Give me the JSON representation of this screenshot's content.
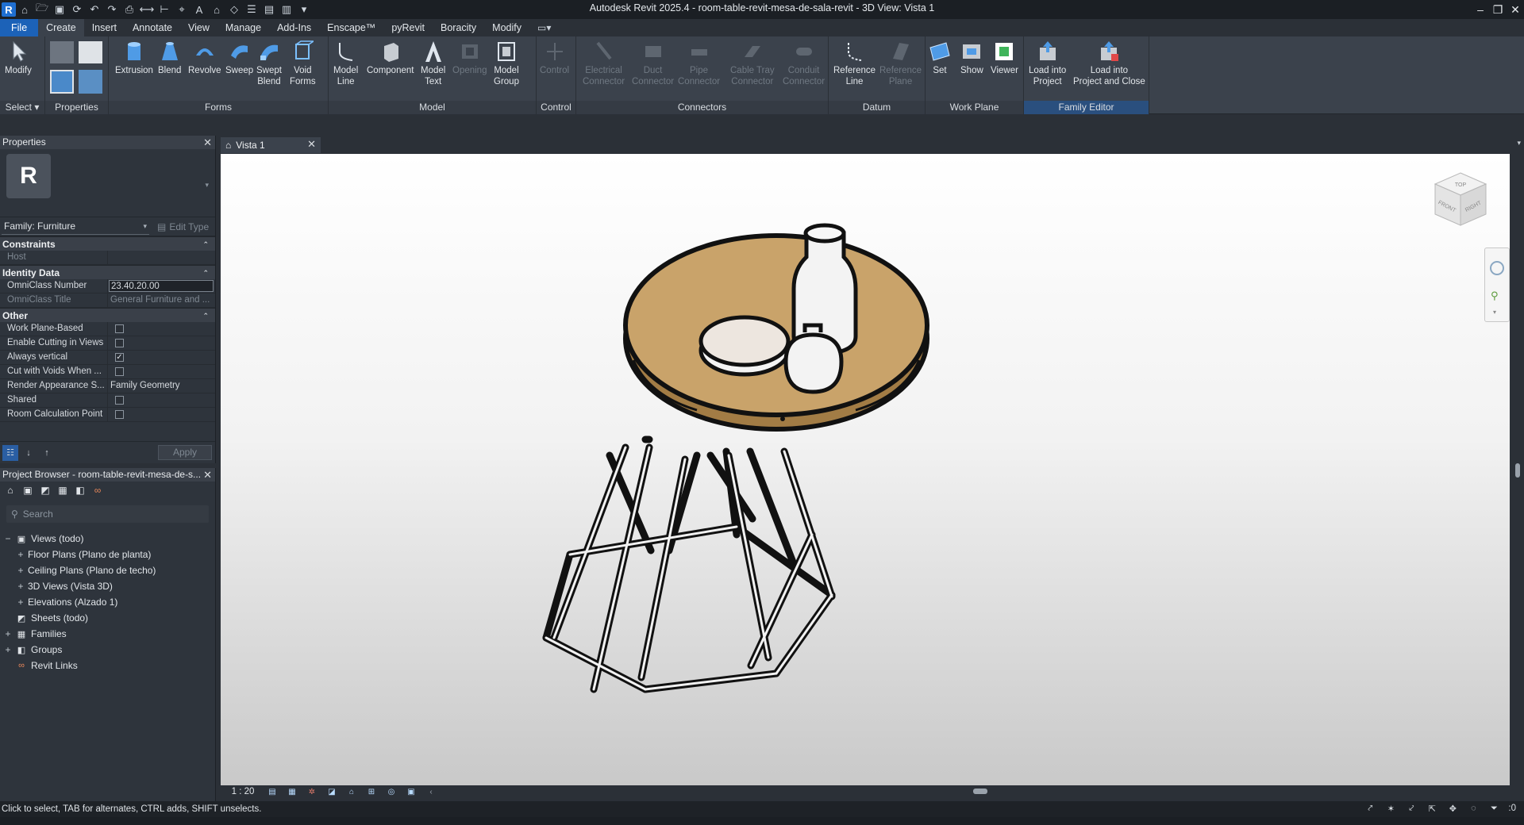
{
  "window": {
    "title": "Autodesk Revit 2025.4 - room-table-revit-mesa-de-sala-revit - 3D View: Vista 1",
    "app_letter": "R"
  },
  "menu": {
    "tabs": [
      "File",
      "Create",
      "Insert",
      "Annotate",
      "View",
      "Manage",
      "Add-Ins",
      "Enscape™",
      "pyRevit",
      "Boracity",
      "Modify"
    ],
    "active": "Create"
  },
  "ribbon": {
    "select": {
      "modify": "Modify",
      "select_label": "Select"
    },
    "properties_label": "Properties",
    "forms": {
      "label": "Forms",
      "buttons": [
        "Extrusion",
        "Blend",
        "Revolve",
        "Sweep",
        "Swept\nBlend",
        "Void\nForms"
      ]
    },
    "model": {
      "label": "Model",
      "buttons": [
        "Model\nLine",
        "Component",
        "Model\nText",
        "Opening",
        "Model\nGroup"
      ]
    },
    "control": {
      "label": "Control",
      "buttons": [
        "Control"
      ]
    },
    "connectors": {
      "label": "Connectors",
      "buttons": [
        "Electrical\nConnector",
        "Duct\nConnector",
        "Pipe\nConnector",
        "Cable Tray\nConnector",
        "Conduit\nConnector"
      ]
    },
    "datum": {
      "label": "Datum",
      "buttons": [
        "Reference\nLine",
        "Reference\nPlane"
      ]
    },
    "work_plane": {
      "label": "Work Plane",
      "buttons": [
        "Set",
        "Show",
        "Viewer"
      ]
    },
    "family_editor": {
      "label": "Family Editor",
      "buttons": [
        "Load into\nProject",
        "Load into\nProject and Close"
      ]
    }
  },
  "properties": {
    "title": "Properties",
    "family": "Family: Furniture",
    "edit_type": "Edit Type",
    "sections": {
      "constraints": "Constraints",
      "identity": "Identity Data",
      "other": "Other"
    },
    "host": "Host",
    "omniclass_number_label": "OmniClass Number",
    "omniclass_number": "23.40.20.00",
    "omniclass_title_label": "OmniClass Title",
    "omniclass_title": "General Furniture and ...",
    "other_rows": [
      {
        "name": "Work Plane-Based",
        "checked": false
      },
      {
        "name": "Enable Cutting in Views",
        "checked": false
      },
      {
        "name": "Always vertical",
        "checked": true
      },
      {
        "name": "Cut with Voids When ...",
        "checked": false
      },
      {
        "name": "Render Appearance S...",
        "value": "Family Geometry"
      },
      {
        "name": "Shared",
        "checked": false
      },
      {
        "name": "Room Calculation Point",
        "checked": false
      }
    ],
    "apply": "Apply"
  },
  "browser": {
    "title": "Project Browser - room-table-revit-mesa-de-s...",
    "search_placeholder": "Search",
    "tree": [
      {
        "label": "Views (todo)",
        "level": 0,
        "exp": "−"
      },
      {
        "label": "Floor Plans (Plano de planta)",
        "level": 1,
        "exp": "+"
      },
      {
        "label": "Ceiling Plans (Plano de techo)",
        "level": 1,
        "exp": "+"
      },
      {
        "label": "3D Views (Vista 3D)",
        "level": 1,
        "exp": "+"
      },
      {
        "label": "Elevations (Alzado 1)",
        "level": 1,
        "exp": "+"
      },
      {
        "label": "Sheets (todo)",
        "level": 0,
        "exp": ""
      },
      {
        "label": "Families",
        "level": 0,
        "exp": "+"
      },
      {
        "label": "Groups",
        "level": 0,
        "exp": "+"
      },
      {
        "label": "Revit Links",
        "level": 0,
        "exp": ""
      }
    ]
  },
  "view": {
    "tab": "Vista 1",
    "scale": "1 : 20",
    "cube": {
      "top": "TOP",
      "front": "FRONT",
      "right": "RIGHT"
    }
  },
  "status": {
    "text": "Click to select, TAB for alternates, CTRL adds, SHIFT unselects.",
    "filter_count": ":0"
  },
  "colors": {
    "accent": "#1c62b8",
    "tabletop": "#c9a36a",
    "canvas_top": "#ffffff",
    "canvas_bottom": "#c9c9c9"
  }
}
